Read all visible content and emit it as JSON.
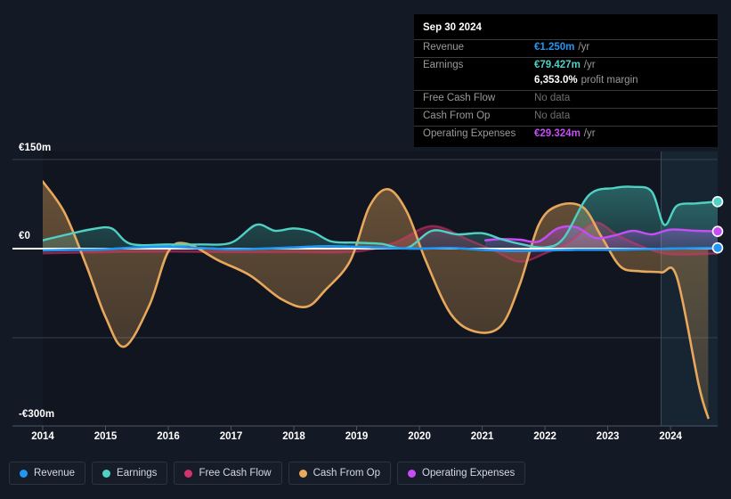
{
  "tooltip": {
    "date": "Sep 30 2024",
    "rows": [
      {
        "label": "Revenue",
        "value": "€1.250m",
        "unit": "/yr",
        "color": "#2196f3",
        "nodata": false
      },
      {
        "label": "Earnings",
        "value": "€79.427m",
        "unit": "/yr",
        "color": "#4fd1c5",
        "nodata": false
      },
      {
        "label": "",
        "value": "6,353.0%",
        "unit": "profit margin",
        "color": "#ffffff",
        "nodata": false,
        "sub": true
      },
      {
        "label": "Free Cash Flow",
        "value": "No data",
        "unit": "",
        "color": "#6e6e6e",
        "nodata": true
      },
      {
        "label": "Cash From Op",
        "value": "No data",
        "unit": "",
        "color": "#6e6e6e",
        "nodata": true
      },
      {
        "label": "Operating Expenses",
        "value": "€29.324m",
        "unit": "/yr",
        "color": "#c64df7",
        "nodata": false
      }
    ]
  },
  "legend": {
    "items": [
      {
        "label": "Revenue",
        "color": "#2196f3"
      },
      {
        "label": "Earnings",
        "color": "#4fd1c5"
      },
      {
        "label": "Free Cash Flow",
        "color": "#d6336c"
      },
      {
        "label": "Cash From Op",
        "color": "#e8a85c"
      },
      {
        "label": "Operating Expenses",
        "color": "#c64df7"
      }
    ]
  },
  "chart_data": {
    "type": "area",
    "title": "",
    "xlabel": "",
    "ylabel": "",
    "grid": true,
    "legend_position": "bottom",
    "ylim": [
      -300,
      150
    ],
    "y_ticks": [
      {
        "value": 150,
        "label": "€150m"
      },
      {
        "value": 0,
        "label": "€0"
      },
      {
        "value": -300,
        "label": "-€300m"
      }
    ],
    "x_ticks": [
      "2014",
      "2015",
      "2016",
      "2017",
      "2018",
      "2019",
      "2020",
      "2021",
      "2022",
      "2023",
      "2024"
    ],
    "x_range": [
      2014.0,
      2024.75
    ],
    "units": "EUR millions per year",
    "forecast_region": {
      "start": 2023.85,
      "end": 2024.75
    },
    "series": [
      {
        "name": "Revenue",
        "color": "#2196f3",
        "x": [
          2014.0,
          2014.5,
          2015.0,
          2015.5,
          2016.0,
          2016.5,
          2017.0,
          2017.5,
          2018.0,
          2018.5,
          2019.0,
          2019.5,
          2020.0,
          2020.5,
          2021.0,
          2021.5,
          2022.0,
          2022.5,
          2023.0,
          2023.5,
          2024.0,
          2024.75
        ],
        "values": [
          -3,
          -2,
          -1,
          2,
          3,
          1,
          -1,
          0,
          2,
          4,
          3,
          1,
          0,
          1,
          -2,
          -4,
          -3,
          -2,
          -2,
          -1,
          0,
          1.25
        ]
      },
      {
        "name": "Earnings",
        "color": "#4fd1c5",
        "x": [
          2014.0,
          2014.4,
          2014.8,
          2015.1,
          2015.4,
          2016.0,
          2016.5,
          2017.0,
          2017.4,
          2017.7,
          2018.0,
          2018.3,
          2018.6,
          2019.0,
          2019.4,
          2019.8,
          2020.2,
          2020.6,
          2021.0,
          2021.3,
          2021.6,
          2022.0,
          2022.3,
          2022.7,
          2023.1,
          2023.4,
          2023.7,
          2023.9,
          2024.1,
          2024.4,
          2024.75
        ],
        "values": [
          14,
          24,
          33,
          34,
          8,
          7,
          7,
          10,
          40,
          30,
          34,
          28,
          12,
          10,
          8,
          1,
          30,
          24,
          26,
          16,
          8,
          2,
          18,
          90,
          102,
          104,
          96,
          40,
          72,
          76,
          79
        ]
      },
      {
        "name": "Free Cash Flow",
        "color": "#d6336c",
        "x": [
          2014.0,
          2015.0,
          2016.0,
          2017.0,
          2018.0,
          2019.0,
          2019.6,
          2020.2,
          2020.8,
          2021.2,
          2021.6,
          2022.0,
          2022.4,
          2022.8,
          2023.2,
          2023.8,
          2024.2,
          2024.75
        ],
        "values": [
          -8,
          -6,
          -5,
          -6,
          -6,
          -5,
          10,
          38,
          14,
          -4,
          -22,
          -8,
          12,
          44,
          20,
          -6,
          -10,
          -8
        ]
      },
      {
        "name": "Cash From Op",
        "color": "#e8a85c",
        "x": [
          2014.0,
          2014.35,
          2014.7,
          2015.0,
          2015.3,
          2015.7,
          2016.0,
          2016.3,
          2016.8,
          2017.3,
          2017.8,
          2018.2,
          2018.5,
          2018.9,
          2019.2,
          2019.5,
          2019.8,
          2020.1,
          2020.5,
          2020.9,
          2021.3,
          2021.6,
          2021.9,
          2022.2,
          2022.6,
          2022.9,
          2023.2,
          2023.5,
          2023.85,
          2024.1,
          2024.45,
          2024.6
        ],
        "values": [
          113,
          60,
          -30,
          -115,
          -165,
          -95,
          -5,
          8,
          -20,
          -45,
          -85,
          -98,
          -70,
          -20,
          70,
          100,
          62,
          -20,
          -110,
          -140,
          -130,
          -60,
          40,
          72,
          70,
          20,
          -30,
          -38,
          -40,
          -48,
          -230,
          -285
        ]
      },
      {
        "name": "Operating Expenses",
        "color": "#c64df7",
        "x": [
          2021.05,
          2021.3,
          2021.6,
          2021.9,
          2022.2,
          2022.5,
          2022.8,
          2023.1,
          2023.4,
          2023.7,
          2024.0,
          2024.4,
          2024.75
        ],
        "values": [
          14,
          16,
          15,
          12,
          34,
          36,
          18,
          22,
          30,
          24,
          32,
          30,
          29
        ]
      }
    ],
    "endpoint_markers": [
      {
        "series": "Earnings",
        "value": 79,
        "color": "#4fd1c5"
      },
      {
        "series": "Operating Expenses",
        "value": 29,
        "color": "#c64df7"
      },
      {
        "series": "Revenue",
        "value": 1.25,
        "color": "#2196f3"
      }
    ]
  }
}
